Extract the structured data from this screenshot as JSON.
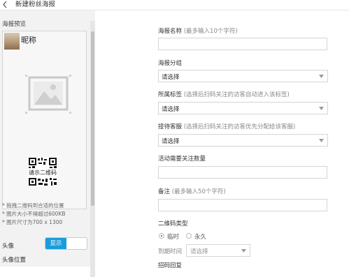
{
  "header": {
    "title": "新建粉丝海报"
  },
  "preview": {
    "label": "海报预览",
    "nickname": "昵称",
    "qr_label": "请示二维码",
    "tips": [
      "* 拖拽二维码到合适的位置",
      "* 图片大小不得超过600KB",
      "* 图片尺寸为700 x 1300"
    ]
  },
  "settings": {
    "avatar_label": "头像",
    "avatar_toggle": "显示",
    "avatar_position_label": "头像位置"
  },
  "form": {
    "poster_name": {
      "label": "海报名称",
      "hint": "(最多输入10个字符)",
      "value": ""
    },
    "poster_group": {
      "label": "海报分组",
      "value": "请选择"
    },
    "tag": {
      "label": "所属标签",
      "hint": "(选择后扫码关注的访客自动进入该标签)",
      "value": "请选择"
    },
    "service": {
      "label": "接待客服",
      "hint": "(选择后扫码关注的访客优先分配给该客服)",
      "value": "请选择"
    },
    "follow_count": {
      "label": "活动需要关注数量",
      "value": ""
    },
    "remark": {
      "label": "备注",
      "hint": "(最多输入50个字符)",
      "value": ""
    },
    "qr_type": {
      "label": "二维码类型",
      "options": [
        "临时",
        "永久"
      ],
      "selected": "临时"
    },
    "expire": {
      "label": "到期时间",
      "placeholder": "请选择"
    },
    "cut_label": "招码回复"
  }
}
